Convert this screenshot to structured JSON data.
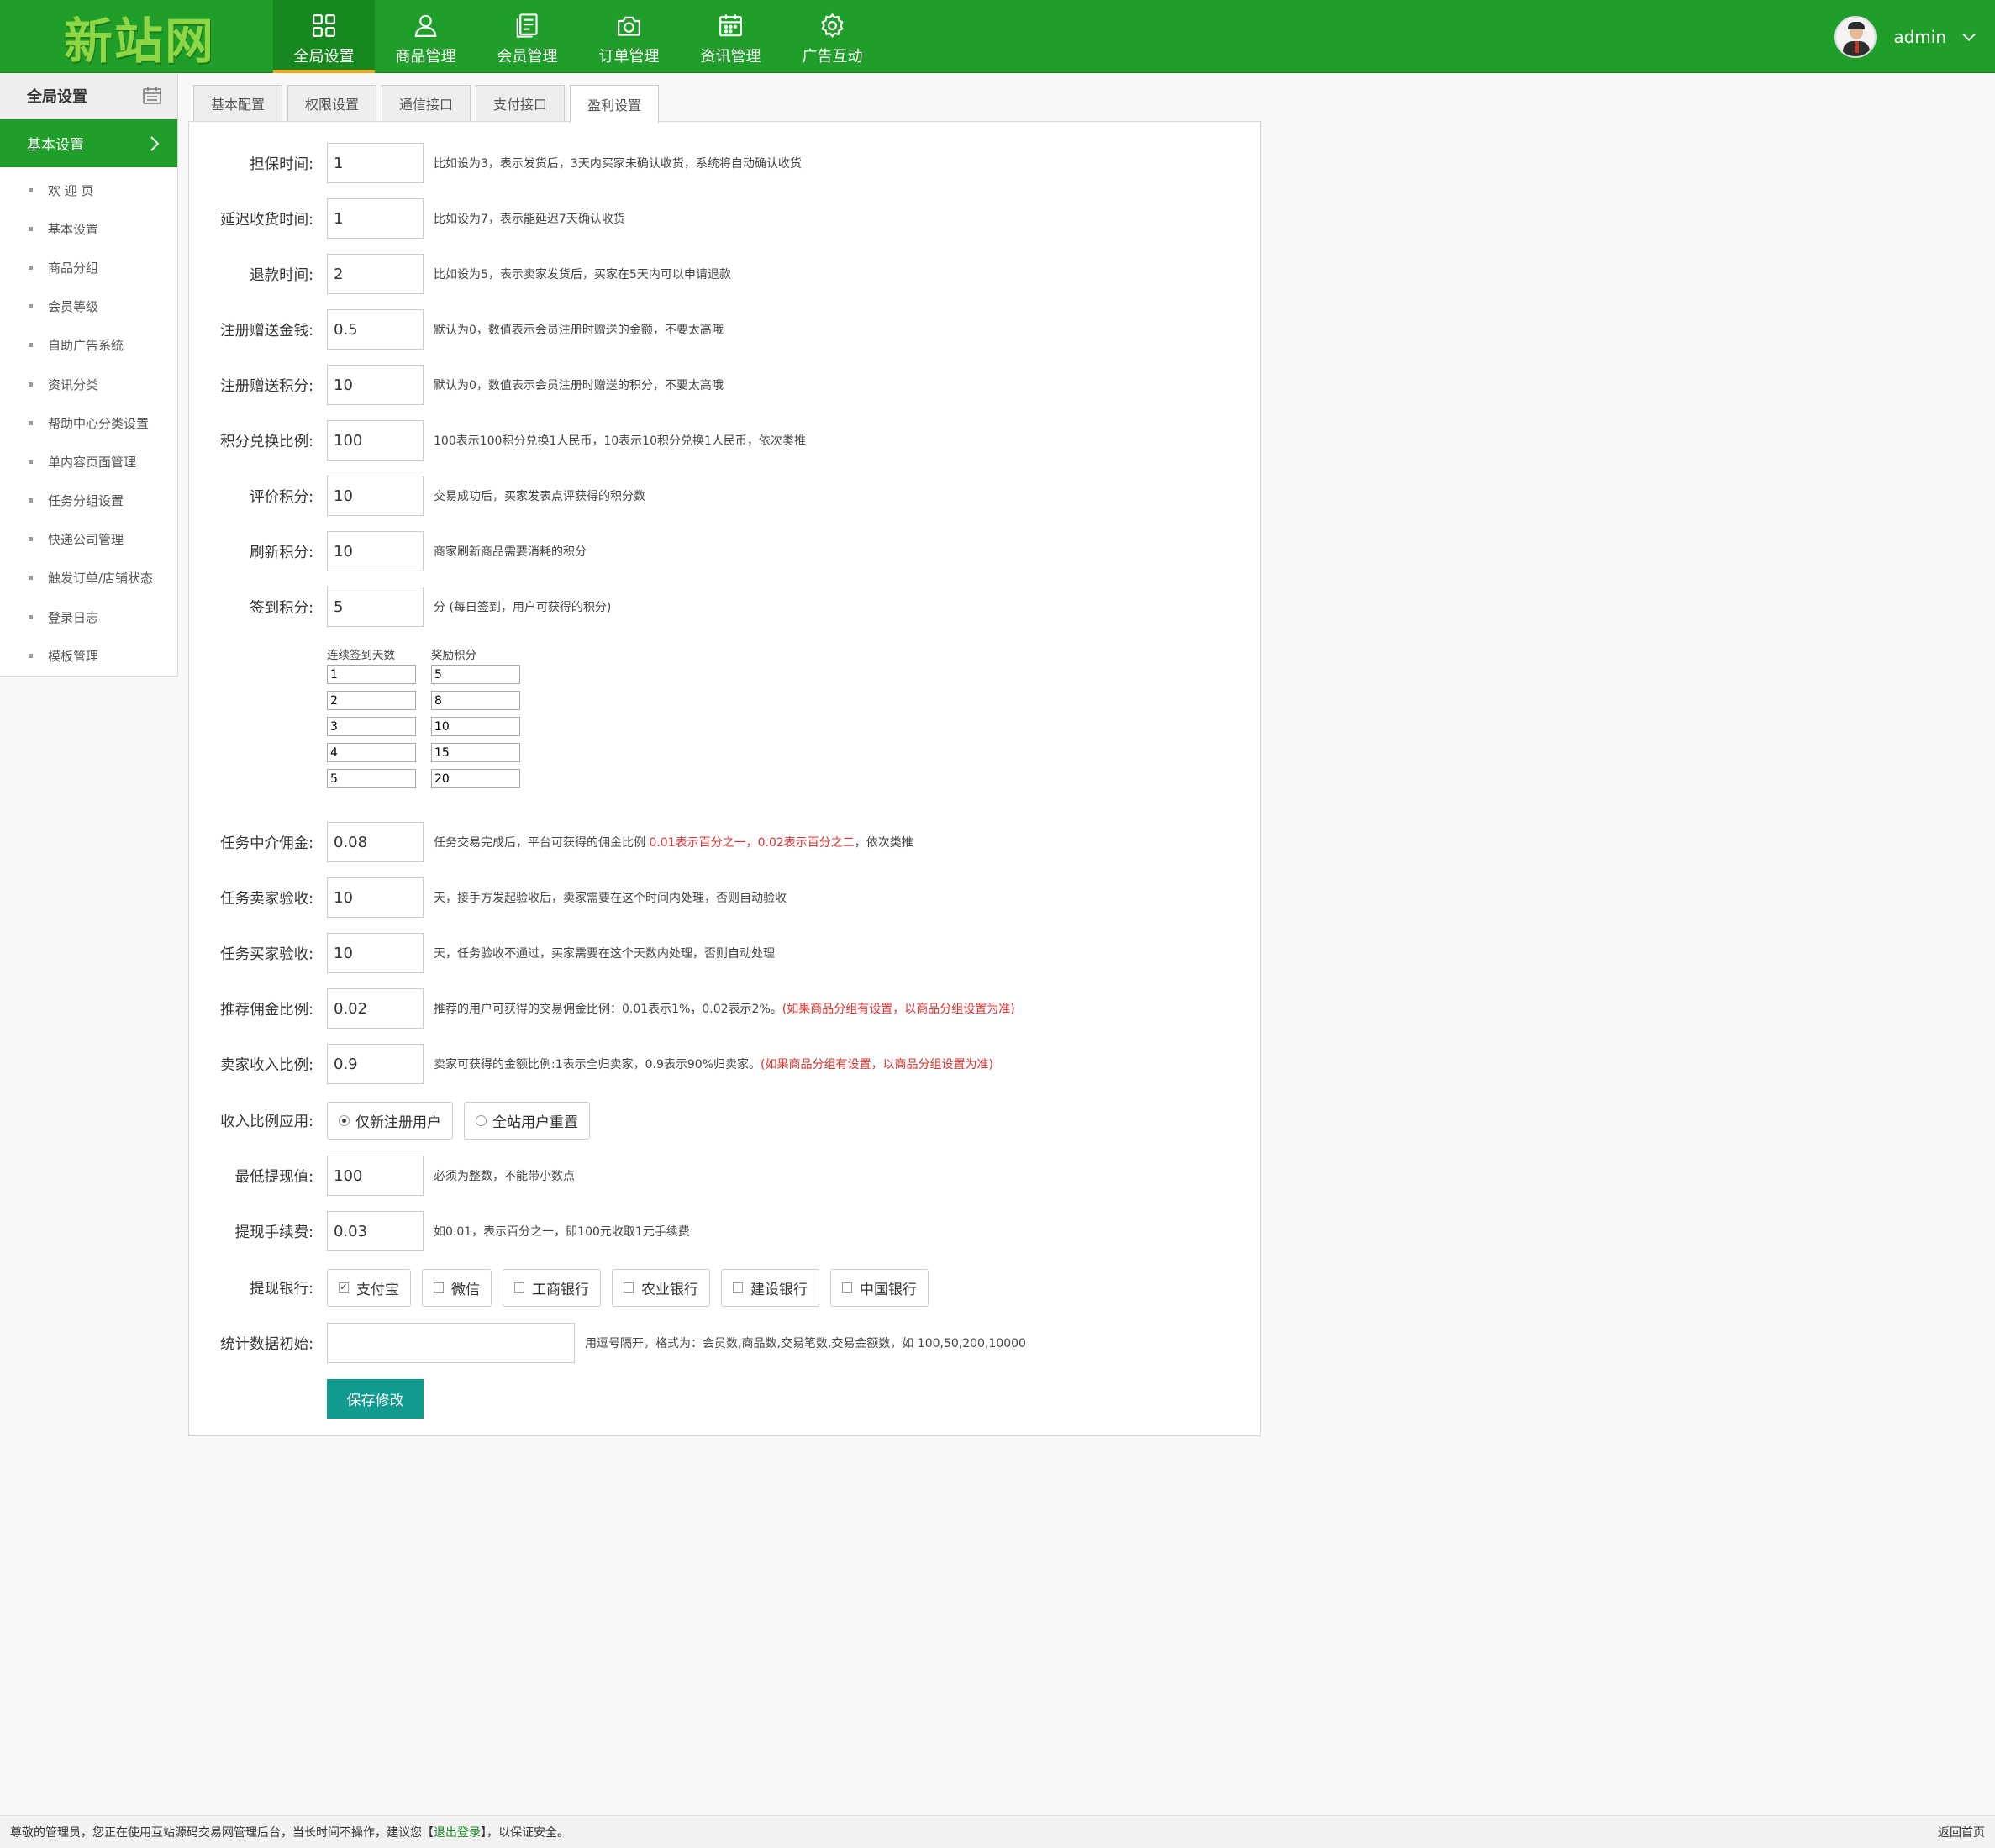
{
  "header": {
    "logo": "新站网",
    "nav": [
      {
        "label": "全局设置",
        "icon": "grid-icon",
        "active": true
      },
      {
        "label": "商品管理",
        "icon": "user-icon"
      },
      {
        "label": "会员管理",
        "icon": "document-icon"
      },
      {
        "label": "订单管理",
        "icon": "camera-icon"
      },
      {
        "label": "资讯管理",
        "icon": "calendar-icon"
      },
      {
        "label": "广告互动",
        "icon": "gear-icon"
      }
    ],
    "user": "admin"
  },
  "sidebar": {
    "title": "全局设置",
    "active": "基本设置",
    "items": [
      "欢 迎 页",
      "基本设置",
      "商品分组",
      "会员等级",
      "自助广告系统",
      "资讯分类",
      "帮助中心分类设置",
      "单内容页面管理",
      "任务分组设置",
      "快递公司管理",
      "触发订单/店铺状态",
      "登录日志",
      "模板管理"
    ]
  },
  "tabs": [
    "基本配置",
    "权限设置",
    "通信接口",
    "支付接口",
    "盈利设置"
  ],
  "form": {
    "rows": [
      {
        "label": "担保时间:",
        "value": "1",
        "hint": "比如设为3，表示发货后，3天内买家未确认收货，系统将自动确认收货"
      },
      {
        "label": "延迟收货时间:",
        "value": "1",
        "hint": "比如设为7，表示能延迟7天确认收货"
      },
      {
        "label": "退款时间:",
        "value": "2",
        "hint": "比如设为5，表示卖家发货后，买家在5天内可以申请退款"
      },
      {
        "label": "注册赠送金钱:",
        "value": "0.5",
        "hint": "默认为0，数值表示会员注册时赠送的金额，不要太高哦"
      },
      {
        "label": "注册赠送积分:",
        "value": "10",
        "hint": "默认为0，数值表示会员注册时赠送的积分，不要太高哦"
      },
      {
        "label": "积分兑换比例:",
        "value": "100",
        "hint": "100表示100积分兑换1人民币，10表示10积分兑换1人民币，依次类推"
      },
      {
        "label": "评价积分:",
        "value": "10",
        "hint": "交易成功后，买家发表点评获得的积分数"
      },
      {
        "label": "刷新积分:",
        "value": "10",
        "hint": "商家刷新商品需要消耗的积分"
      },
      {
        "label": "签到积分:",
        "value": "5",
        "hint": "分 (每日签到，用户可获得的积分)"
      }
    ],
    "sign": {
      "head_days": "连续签到天数",
      "head_points": "奖励积分",
      "rows": [
        [
          "1",
          "5"
        ],
        [
          "2",
          "8"
        ],
        [
          "3",
          "10"
        ],
        [
          "4",
          "15"
        ],
        [
          "5",
          "20"
        ]
      ]
    },
    "rows2": [
      {
        "label": "任务中介佣金:",
        "value": "0.08",
        "hint": "任务交易完成后，平台可获得的佣金比例 ",
        "hint_red": "0.01表示百分之一，0.02表示百分之二",
        "hint_tail": "，依次类推"
      },
      {
        "label": "任务卖家验收:",
        "value": "10",
        "hint": "天，接手方发起验收后，卖家需要在这个时间内处理，否则自动验收",
        "hint_red": "",
        "hint_tail": ""
      },
      {
        "label": "任务买家验收:",
        "value": "10",
        "hint": "天，任务验收不通过，买家需要在这个天数内处理，否则自动处理",
        "hint_red": "",
        "hint_tail": ""
      },
      {
        "label": "推荐佣金比例:",
        "value": "0.02",
        "hint": "推荐的用户可获得的交易佣金比例：0.01表示1%，0.02表示2%。",
        "hint_red": "(如果商品分组有设置，以商品分组设置为准)",
        "hint_tail": ""
      },
      {
        "label": "卖家收入比例:",
        "value": "0.9",
        "hint": "卖家可获得的金额比例:1表示全归卖家，0.9表示90%归卖家。",
        "hint_red": "(如果商品分组有设置，以商品分组设置为准)",
        "hint_tail": ""
      }
    ],
    "apply": {
      "label": "收入比例应用:",
      "options": [
        "仅新注册用户",
        "全站用户重置"
      ],
      "selected": 0
    },
    "rows3": [
      {
        "label": "最低提现值:",
        "value": "100",
        "hint": "必须为整数，不能带小数点"
      },
      {
        "label": "提现手续费:",
        "value": "0.03",
        "hint": "如0.01，表示百分之一，即100元收取1元手续费"
      }
    ],
    "banks": {
      "label": "提现银行:",
      "options": [
        "支付宝",
        "微信",
        "工商银行",
        "农业银行",
        "建设银行",
        "中国银行"
      ],
      "checked": [
        true,
        false,
        false,
        false,
        false,
        false
      ]
    },
    "stats": {
      "label": "统计数据初始:",
      "value": "",
      "hint": "用逗号隔开，格式为：会员数,商品数,交易笔数,交易金额数，如 100,50,200,10000"
    },
    "save": "保存修改"
  },
  "footer": {
    "text_before": "尊敬的管理员，您正在使用互站源码交易网管理后台，当长时间不操作，建议您【",
    "link": "退出登录",
    "text_after": "】，以保证安全。",
    "right": "返回首页"
  },
  "colors": {
    "brand": "#1f9e29",
    "accent": "#f7a81b",
    "button": "#119b8e",
    "warn": "#e0302f"
  }
}
